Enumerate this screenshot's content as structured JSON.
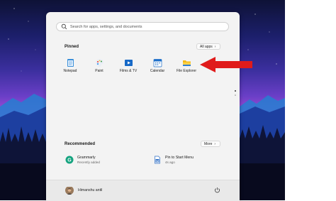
{
  "search": {
    "placeholder": "Search for apps, settings, and documents"
  },
  "pinned": {
    "title": "Pinned",
    "all_apps_label": "All apps",
    "apps": [
      {
        "label": "Notepad",
        "icon": "notepad-icon"
      },
      {
        "label": "Paint",
        "icon": "paint-icon"
      },
      {
        "label": "Films & TV",
        "icon": "films-tv-icon"
      },
      {
        "label": "Calendar",
        "icon": "calendar-icon"
      },
      {
        "label": "File Explorer",
        "icon": "folder-icon"
      }
    ]
  },
  "recommended": {
    "title": "Recommended",
    "more_label": "More",
    "items": [
      {
        "name": "Grammarly",
        "sub": "Recently added",
        "icon": "grammarly-icon"
      },
      {
        "name": "Pin to Start Menu",
        "sub": "4s ago",
        "icon": "document-icon"
      }
    ]
  },
  "user": {
    "name": "Himanshu antil"
  },
  "colors": {
    "arrow": "#e01b1b",
    "accent": "#0067c0"
  }
}
